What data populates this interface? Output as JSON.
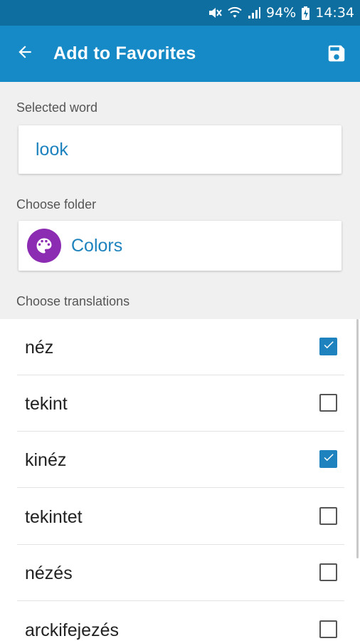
{
  "status_bar": {
    "battery": "94%",
    "time": "14:34",
    "icons": [
      "mute-icon",
      "wifi-icon",
      "signal-icon",
      "battery-icon"
    ]
  },
  "app_bar": {
    "title": "Add to Favorites",
    "back_icon": "arrow-back-icon",
    "save_icon": "save-icon",
    "color": "#168ac6"
  },
  "selected_word": {
    "label": "Selected word",
    "value": "look"
  },
  "folder": {
    "label": "Choose folder",
    "name": "Colors",
    "icon": "palette-icon",
    "icon_color": "#8c2cb2"
  },
  "translations": {
    "label": "Choose translations",
    "items": [
      {
        "text": "néz",
        "checked": true
      },
      {
        "text": "tekint",
        "checked": false
      },
      {
        "text": "kinéz",
        "checked": true
      },
      {
        "text": "tekintet",
        "checked": false
      },
      {
        "text": "nézés",
        "checked": false
      },
      {
        "text": "arckifejezés",
        "checked": false
      }
    ]
  }
}
